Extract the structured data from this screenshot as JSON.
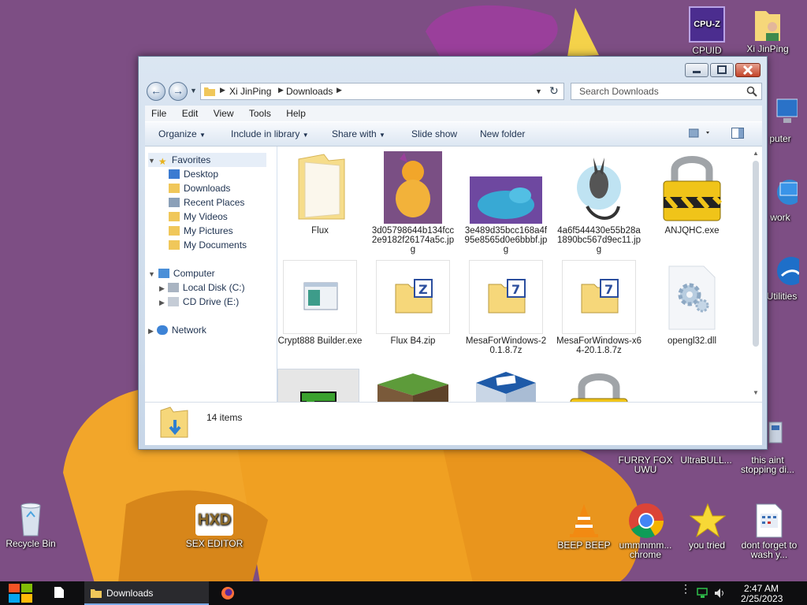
{
  "colors": {
    "wallpaper": "#7d4e84",
    "character_orange": "#f2a62a",
    "window_frame": "#c7d6e8",
    "close_button": "#c3442a",
    "taskbar": "#0e0e10"
  },
  "desktop": {
    "icons": [
      {
        "label": "CPUID",
        "icon": "cpu-z-icon"
      },
      {
        "label": "Xi JinPing",
        "icon": "user-folder-icon"
      },
      {
        "label": "puter",
        "icon": "computer-icon"
      },
      {
        "label": "work",
        "icon": "network-icon"
      },
      {
        "label": "Utilities",
        "icon": "utilities-icon"
      },
      {
        "label": "FURRY FOX UWU",
        "icon": "fox-icon"
      },
      {
        "label": "UltraBULL...",
        "icon": "app-icon"
      },
      {
        "label": "this aint stopping di...",
        "icon": "computer-icon"
      },
      {
        "label": "Recycle Bin",
        "icon": "recycle-bin-icon"
      },
      {
        "label": "SEX EDITOR",
        "icon": "hxd-icon"
      },
      {
        "label": "BEEP BEEP",
        "icon": "vlc-cone-icon"
      },
      {
        "label": "ummmmm... chrome",
        "icon": "chrome-icon"
      },
      {
        "label": "you tried",
        "icon": "star-icon"
      },
      {
        "label": "dont forget to wash y...",
        "icon": "calendar-doc-icon"
      }
    ]
  },
  "window": {
    "breadcrumb": [
      "Xi JinPing",
      "Downloads"
    ],
    "search_placeholder": "Search Downloads",
    "menu": [
      "File",
      "Edit",
      "View",
      "Tools",
      "Help"
    ],
    "commands": [
      "Organize",
      "Include in library",
      "Share with",
      "Slide show",
      "New folder"
    ],
    "nav": {
      "favorites": "Favorites",
      "favorites_items": [
        "Desktop",
        "Downloads",
        "Recent Places",
        "My Videos",
        "My Pictures",
        "My Documents"
      ],
      "computer": "Computer",
      "computer_items": [
        "Local Disk (C:)",
        "CD Drive (E:)"
      ],
      "network": "Network"
    },
    "files": [
      {
        "name": "Flux",
        "icon": "folder-icon"
      },
      {
        "name": "3d05798644b134fcc2e9182f26174a5c.jpg",
        "icon": "image-orange-icon"
      },
      {
        "name": "3e489d35bcc168a4f95e8565d0e6bbbf.jpg",
        "icon": "image-blue-icon"
      },
      {
        "name": "4a6f544430e55b28a1890bc567d9ec11.jpg",
        "icon": "image-gray-icon"
      },
      {
        "name": "ANJQHC.exe",
        "icon": "padlock-icon"
      },
      {
        "name": "Crypt888 Builder.exe",
        "icon": "exe-window-icon"
      },
      {
        "name": "Flux B4.zip",
        "icon": "zip-archive-icon"
      },
      {
        "name": "MesaForWindows-20.1.8.7z",
        "icon": "7z-archive-icon"
      },
      {
        "name": "MesaForWindows-x64-20.1.8.7z",
        "icon": "7z-archive-icon"
      },
      {
        "name": "opengl32.dll",
        "icon": "dll-gear-icon"
      },
      {
        "name": "",
        "icon": "green-app-icon"
      },
      {
        "name": "",
        "icon": "minecraft-icon"
      },
      {
        "name": "",
        "icon": "virtualbox-icon"
      },
      {
        "name": "",
        "icon": "padlock-icon"
      }
    ],
    "status": "14 items"
  },
  "taskbar": {
    "task_label": "Downloads",
    "time": "2:47 AM",
    "date": "2/25/2023"
  }
}
